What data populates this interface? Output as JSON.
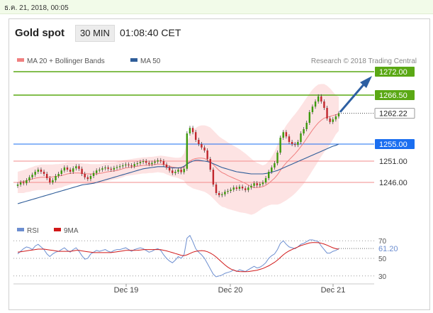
{
  "header": {
    "datetime": "ธ.ค. 21, 2018, 00:05",
    "instrument": "Gold spot",
    "timeframe": "30 MIN",
    "time": "01:08:40 CET"
  },
  "colors": {
    "resistance": "#5aa814",
    "support": "#f28b8b",
    "pivot": "#1a6ef0",
    "current": "#222222",
    "ma20": "#f08080",
    "bollinger": "#fde0e0",
    "ma50": "#2f5d99",
    "candle_up": "#3c9a0c",
    "candle_down": "#c0262c",
    "arrow": "#2d5fa2",
    "rsi": "#6c8ed0",
    "rsi_ma": "#d11818"
  },
  "chart_data": [
    {
      "type": "candlestick",
      "title": "Gold spot",
      "legend": [
        {
          "name": "MA 20 + Bollinger Bands",
          "color": "#f08080"
        },
        {
          "name": "MA 50",
          "color": "#2f5d99"
        }
      ],
      "credit": "Research © 2018 Trading Central",
      "x_tick_labels": [
        "Dec 19",
        "Dec 20",
        "Dec 21"
      ],
      "ylim": [
        1238,
        1276
      ],
      "levels": [
        {
          "label": "1272.00",
          "value": 1272.0,
          "kind": "resistance"
        },
        {
          "label": "1266.50",
          "value": 1266.5,
          "kind": "resistance"
        },
        {
          "label": "1262.22",
          "value": 1262.22,
          "kind": "current"
        },
        {
          "label": "1255.00",
          "value": 1255.0,
          "kind": "pivot"
        },
        {
          "label": "1251.00",
          "value": 1251.0,
          "kind": "support"
        },
        {
          "label": "1246.00",
          "value": 1246.0,
          "kind": "support"
        }
      ],
      "close": [
        1245.5,
        1246.0,
        1245.8,
        1246.5,
        1247.2,
        1247.8,
        1248.5,
        1249.0,
        1248.5,
        1248.0,
        1247.0,
        1246.0,
        1246.5,
        1247.5,
        1248.0,
        1248.8,
        1249.5,
        1249.0,
        1248.5,
        1249.3,
        1249.8,
        1249.2,
        1248.0,
        1247.2,
        1246.8,
        1247.5,
        1248.2,
        1248.8,
        1249.0,
        1249.3,
        1249.5,
        1249.2,
        1249.0,
        1249.4,
        1249.6,
        1249.8,
        1250.0,
        1250.2,
        1250.0,
        1249.8,
        1250.3,
        1250.5,
        1250.8,
        1251.0,
        1250.6,
        1250.3,
        1250.6,
        1250.9,
        1251.2,
        1251.0,
        1250.2,
        1249.5,
        1248.8,
        1248.2,
        1248.5,
        1249.0,
        1248.4,
        1249.2,
        1257.5,
        1258.8,
        1257.8,
        1256.0,
        1255.0,
        1254.2,
        1253.5,
        1251.5,
        1249.0,
        1245.5,
        1243.5,
        1243.0,
        1243.2,
        1243.8,
        1244.0,
        1244.3,
        1244.8,
        1244.5,
        1245.0,
        1244.6,
        1244.2,
        1244.8,
        1245.2,
        1245.8,
        1245.3,
        1245.6,
        1246.0,
        1247.0,
        1248.5,
        1249.5,
        1250.5,
        1253.0,
        1256.5,
        1257.8,
        1256.8,
        1255.5,
        1255.0,
        1254.8,
        1255.5,
        1257.5,
        1258.5,
        1260.0,
        1262.5,
        1263.8,
        1265.0,
        1266.2,
        1265.0,
        1263.5,
        1261.0,
        1260.2,
        1260.8,
        1261.5,
        1262.2
      ],
      "ma20": [
        1246.0,
        1246.1,
        1246.2,
        1246.4,
        1246.6,
        1246.8,
        1247.0,
        1247.1,
        1247.2,
        1247.2,
        1247.2,
        1247.2,
        1247.3,
        1247.4,
        1247.5,
        1247.6,
        1247.8,
        1248.0,
        1248.1,
        1248.2,
        1248.2,
        1248.2,
        1248.1,
        1248.0,
        1248.0,
        1248.0,
        1248.0,
        1248.0,
        1248.1,
        1248.2,
        1248.4,
        1248.5,
        1248.6,
        1248.7,
        1248.8,
        1249.0,
        1249.2,
        1249.4,
        1249.5,
        1249.6,
        1249.7,
        1249.8,
        1249.9,
        1250.0,
        1250.0,
        1250.1,
        1250.1,
        1250.2,
        1250.3,
        1250.3,
        1250.2,
        1250.0,
        1249.8,
        1249.6,
        1249.5,
        1249.4,
        1249.3,
        1249.6,
        1250.4,
        1251.0,
        1251.4,
        1251.6,
        1251.7,
        1251.7,
        1251.6,
        1251.3,
        1250.9,
        1250.2,
        1249.5,
        1248.8,
        1248.3,
        1248.0,
        1247.6,
        1247.3,
        1247.0,
        1246.7,
        1246.4,
        1246.1,
        1245.8,
        1245.4,
        1245.0,
        1244.8,
        1244.8,
        1244.9,
        1245.0,
        1245.3,
        1245.8,
        1246.4,
        1247.0,
        1247.8,
        1248.8,
        1249.8,
        1250.6,
        1251.3,
        1252.0,
        1252.7,
        1253.5,
        1254.4,
        1255.3,
        1256.3,
        1257.3,
        1258.3,
        1259.2,
        1260.0,
        1260.6,
        1261.1,
        1261.3,
        1261.5,
        1261.7,
        1261.9,
        1262.1
      ],
      "bb_width": [
        2.5,
        2.6,
        2.7,
        2.7,
        2.8,
        2.8,
        2.9,
        2.9,
        3.0,
        3.0,
        3.0,
        3.0,
        2.9,
        2.9,
        2.8,
        2.8,
        2.7,
        2.7,
        2.6,
        2.5,
        2.5,
        2.4,
        2.4,
        2.4,
        2.4,
        2.3,
        2.3,
        2.3,
        2.2,
        2.2,
        2.2,
        2.1,
        2.1,
        2.0,
        2.0,
        2.0,
        2.0,
        1.9,
        1.9,
        1.9,
        1.9,
        1.9,
        1.9,
        1.9,
        1.9,
        1.9,
        1.9,
        1.9,
        1.9,
        2.0,
        2.0,
        2.1,
        2.2,
        2.3,
        2.3,
        2.4,
        2.6,
        3.2,
        5.0,
        6.0,
        6.8,
        7.2,
        7.5,
        7.7,
        7.8,
        7.9,
        8.0,
        8.0,
        8.0,
        8.0,
        8.0,
        7.9,
        7.8,
        7.7,
        7.6,
        7.5,
        7.4,
        7.2,
        7.0,
        6.8,
        6.6,
        6.2,
        5.8,
        5.4,
        5.0,
        5.0,
        5.2,
        5.6,
        6.2,
        7.0,
        7.8,
        8.4,
        8.8,
        9.0,
        9.2,
        9.3,
        9.4,
        9.5,
        9.6,
        9.6,
        9.6,
        9.5,
        9.3,
        9.0,
        8.5,
        8.0,
        7.4,
        6.6,
        5.6,
        4.6,
        4.0
      ],
      "ma50": [
        1241.0,
        1241.2,
        1241.4,
        1241.6,
        1241.8,
        1242.0,
        1242.2,
        1242.4,
        1242.6,
        1242.8,
        1243.0,
        1243.2,
        1243.4,
        1243.6,
        1243.8,
        1244.0,
        1244.2,
        1244.4,
        1244.6,
        1244.8,
        1245.0,
        1245.2,
        1245.4,
        1245.5,
        1245.6,
        1245.7,
        1245.8,
        1246.0,
        1246.2,
        1246.4,
        1246.6,
        1246.8,
        1247.0,
        1247.2,
        1247.4,
        1247.6,
        1247.8,
        1248.0,
        1248.2,
        1248.4,
        1248.6,
        1248.8,
        1249.0,
        1249.2,
        1249.3,
        1249.4,
        1249.5,
        1249.6,
        1249.7,
        1249.7,
        1249.7,
        1249.6,
        1249.5,
        1249.4,
        1249.4,
        1249.4,
        1249.5,
        1249.8,
        1250.3,
        1250.7,
        1251.0,
        1251.2,
        1251.2,
        1251.1,
        1251.0,
        1250.9,
        1250.7,
        1250.4,
        1250.1,
        1249.8,
        1249.5,
        1249.3,
        1249.1,
        1248.9,
        1248.7,
        1248.5,
        1248.4,
        1248.3,
        1248.2,
        1248.1,
        1248.0,
        1248.0,
        1248.0,
        1248.0,
        1248.0,
        1248.1,
        1248.2,
        1248.4,
        1248.6,
        1248.8,
        1249.1,
        1249.4,
        1249.7,
        1250.0,
        1250.3,
        1250.6,
        1250.9,
        1251.2,
        1251.5,
        1251.8,
        1252.1,
        1252.4,
        1252.7,
        1253.0,
        1253.3,
        1253.6,
        1253.9,
        1254.2,
        1254.5,
        1254.7,
        1255.0
      ]
    },
    {
      "type": "line",
      "legend": [
        {
          "name": "RSI",
          "color": "#6c8ed0"
        },
        {
          "name": "9MA",
          "color": "#d11818"
        }
      ],
      "y_tick_labels": [
        "70",
        "50",
        "30"
      ],
      "y_ticks": [
        70,
        50,
        30
      ],
      "ylim": [
        25,
        75
      ],
      "last_value_label": "61.20",
      "last_value": 61.2,
      "series": [
        {
          "name": "RSI",
          "values": [
            55,
            58,
            61,
            63,
            62,
            60,
            64,
            66,
            63,
            60,
            55,
            52,
            55,
            57,
            58,
            60,
            62,
            59,
            57,
            60,
            62,
            58,
            53,
            49,
            50,
            55,
            57,
            59,
            58,
            59,
            60,
            58,
            57,
            59,
            60,
            60,
            61,
            62,
            60,
            58,
            60,
            61,
            62,
            61,
            59,
            57,
            58,
            60,
            61,
            59,
            54,
            50,
            47,
            45,
            48,
            52,
            50,
            54,
            73,
            76,
            69,
            61,
            57,
            54,
            50,
            44,
            38,
            32,
            29,
            30,
            31,
            33,
            34,
            35,
            37,
            35,
            37,
            36,
            35,
            37,
            39,
            41,
            39,
            40,
            42,
            45,
            50,
            53,
            55,
            60,
            67,
            70,
            66,
            63,
            62,
            61,
            63,
            66,
            67,
            69,
            71,
            71,
            70,
            69,
            64,
            60,
            56,
            56,
            58,
            59,
            61
          ]
        },
        {
          "name": "9MA",
          "values": [
            57,
            57.5,
            58,
            58.5,
            59,
            59.5,
            60,
            60.5,
            60.5,
            60.5,
            60,
            59.5,
            59,
            58.5,
            58,
            58,
            58,
            58,
            58,
            58.5,
            59,
            59,
            58.5,
            58,
            57.5,
            57,
            56.5,
            56.5,
            56.5,
            56.5,
            56.5,
            56.5,
            56.5,
            57,
            57.5,
            58,
            58.5,
            59,
            59,
            59,
            59,
            59.2,
            59.5,
            59.8,
            60,
            60,
            60,
            60,
            60,
            59.8,
            59.2,
            58.5,
            57.5,
            56.5,
            55.5,
            54.5,
            53.5,
            53,
            54,
            55.5,
            57,
            58,
            58.5,
            58.8,
            58.5,
            57.5,
            56,
            54,
            51.5,
            48.5,
            45.5,
            42.5,
            40,
            38,
            36.5,
            35.5,
            35,
            34.8,
            34.8,
            35,
            35.5,
            36,
            36.5,
            37.5,
            38.5,
            40,
            41.5,
            43.5,
            45.5,
            48,
            51,
            54,
            56.5,
            58.5,
            60,
            61.5,
            63,
            64.5,
            65.5,
            66.5,
            67.5,
            68,
            68,
            67.8,
            67.2,
            66.2,
            65,
            63.5,
            62,
            61,
            60.5
          ]
        }
      ]
    }
  ]
}
